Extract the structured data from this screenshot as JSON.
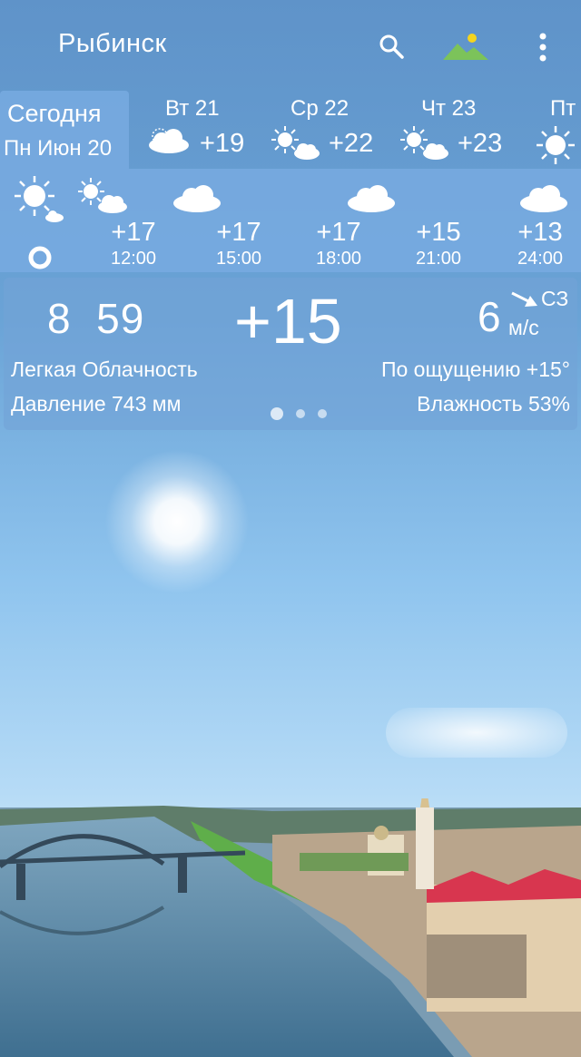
{
  "header": {
    "city": "Рыбинск",
    "icons": [
      "search-icon",
      "landscape-icon",
      "more-vert-icon"
    ]
  },
  "days": {
    "today": {
      "label": "Сегодня",
      "date": "Пн Июн 20"
    },
    "items": [
      {
        "name": "Вт 21",
        "temp": "+19",
        "icon": "cloudy-icon"
      },
      {
        "name": "Ср 22",
        "temp": "+22",
        "icon": "partly-sunny-icon"
      },
      {
        "name": "Чт 23",
        "temp": "+23",
        "icon": "partly-sunny-icon"
      },
      {
        "name": "Пт",
        "temp": "",
        "icon": "sun-icon"
      }
    ]
  },
  "hourly": [
    {
      "time": "12:00",
      "temp": "+17",
      "icon": "partly-sunny-icon"
    },
    {
      "time": "15:00",
      "temp": "+17",
      "icon": "cloud-icon"
    },
    {
      "time": "18:00",
      "temp": "+17",
      "icon": "cloud-icon"
    },
    {
      "time": "21:00",
      "temp": "+15",
      "icon": "cloud-icon"
    },
    {
      "time": "24:00",
      "temp": "+13",
      "icon": "cloud-icon"
    }
  ],
  "current": {
    "clock": "8  59",
    "temp": "+15",
    "wind_speed": "6",
    "wind_dir": "СЗ",
    "wind_unit": "м/с",
    "condition": "Легкая Облачность",
    "feels_like": "По ощущению +15°",
    "pressure": "Давление 743 мм",
    "humidity": "Влажность 53%"
  },
  "colors": {
    "panel": "#78aae1",
    "sky_top": "#5f93c9",
    "sun": "#ffffff"
  }
}
